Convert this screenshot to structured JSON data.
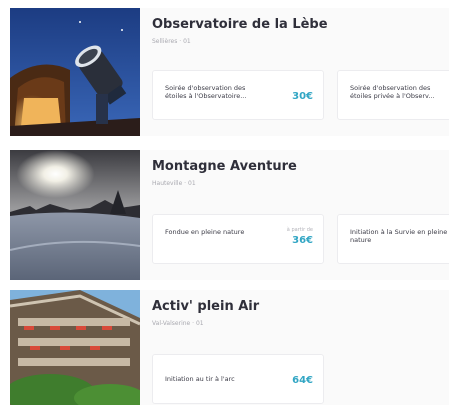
{
  "listings": [
    {
      "title": "Observatoire de la Lèbe",
      "subtitle": "Sellières · 01",
      "image_icon": "observatory-telescope-photo",
      "offers": [
        {
          "label": "Soirée d'observation des étoiles à l'Observatoire...",
          "price": "30€"
        },
        {
          "label": "Soirée d'observation des étoiles privée à l'Observ..."
        }
      ]
    },
    {
      "title": "Montagne Aventure",
      "subtitle": "Hauteville · 01",
      "image_icon": "snowy-sunset-photo",
      "offers": [
        {
          "label": "Fondue en pleine nature",
          "price_note": "à partir de",
          "price": "36€"
        },
        {
          "label": "Initiation à la Survie en pleine nature"
        }
      ]
    },
    {
      "title": "Activ' plein Air",
      "subtitle": "Val-Valserine · 01",
      "image_icon": "chalet-building-photo",
      "offers": [
        {
          "label": "Initiation au tir à l'arc",
          "price": "64€"
        }
      ]
    }
  ],
  "colors": {
    "price": "#32a6c4",
    "title": "#2f2f3a",
    "card_bg": "#fafafa"
  }
}
